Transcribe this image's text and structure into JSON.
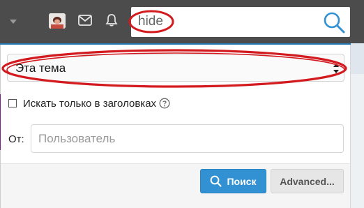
{
  "header": {
    "menu_icon": "caret-down-icon",
    "avatar_icon": "avatar-icon",
    "inbox_icon": "mail-icon",
    "alerts_icon": "bell-icon"
  },
  "search": {
    "query": "hide",
    "button_icon": "search-icon"
  },
  "scope_select": {
    "selected": "Эта тема"
  },
  "titles_only": {
    "label": "Искать только в заголовках",
    "checked": false,
    "help_icon": "question-circle-icon"
  },
  "from_field": {
    "label": "От:",
    "placeholder": "Пользователь",
    "value": ""
  },
  "actions": {
    "search_label": "Поиск",
    "advanced_label": "Advanced..."
  },
  "colors": {
    "accent": "#2577b1",
    "button_blue": "#3191d2",
    "annotation_red": "#d31a1f"
  }
}
